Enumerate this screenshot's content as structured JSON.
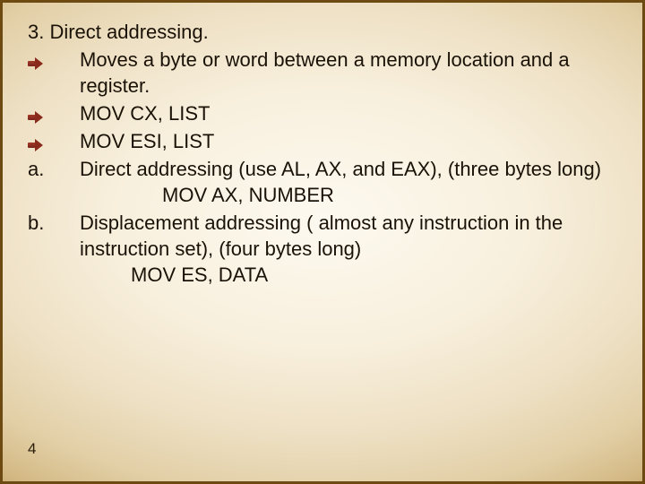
{
  "slide": {
    "heading": "3. Direct addressing.",
    "bullets": [
      " Moves a byte or word between a memory location and a register.",
      " MOV CX, LIST",
      " MOV ESI, LIST"
    ],
    "items": [
      {
        "marker": "a.",
        "text": "Direct addressing (use AL, AX, and EAX), (three bytes long)",
        "example": "MOV AX, NUMBER"
      },
      {
        "marker": "b.",
        "text": "Displacement addressing ( almost any instruction in the instruction set), (four bytes long)",
        "example": "MOV ES, DATA"
      }
    ],
    "page_number": "4"
  }
}
